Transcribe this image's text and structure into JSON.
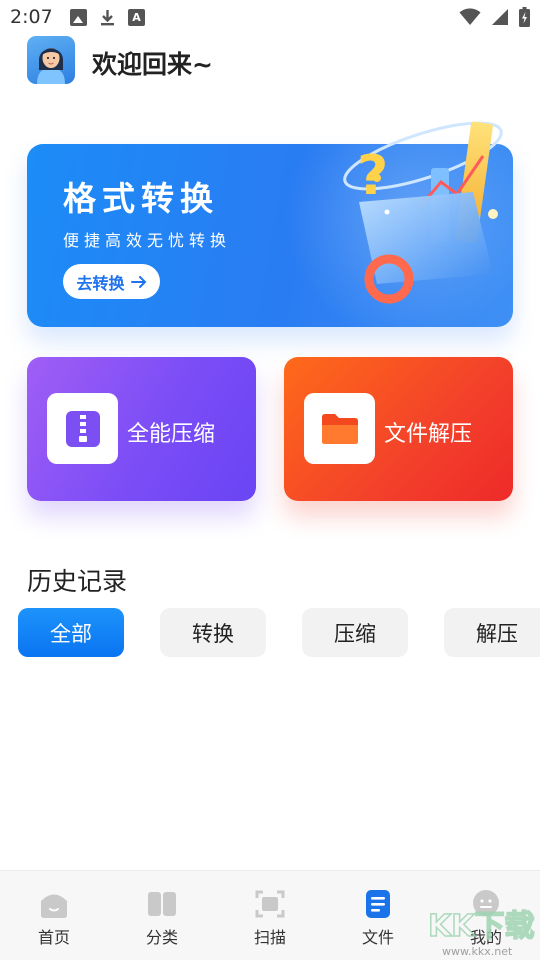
{
  "status_bar": {
    "time": "2:07",
    "left_icons": [
      "image-icon",
      "download-icon",
      "a-badge-icon"
    ],
    "right_icons": [
      "wifi-icon",
      "signal-icon",
      "battery-icon"
    ]
  },
  "header": {
    "avatar": "avatar",
    "welcome_text": "欢迎回来~"
  },
  "banner": {
    "title": "格式转换",
    "subtitle": "便捷高效无忧转换",
    "button_label": "去转换",
    "button_icon": "arrow-right-icon",
    "colors": {
      "start": "#1c8cf7",
      "end": "#3f90f5"
    }
  },
  "features": [
    {
      "label": "全能压缩",
      "icon": "zip-file-icon",
      "color": "#7b4df6"
    },
    {
      "label": "文件解压",
      "icon": "folder-icon",
      "color": "#f3412a"
    }
  ],
  "history": {
    "title": "历史记录",
    "filters": [
      "全部",
      "转换",
      "压缩",
      "解压"
    ],
    "active_filter": "全部"
  },
  "bottom_nav": {
    "items": [
      {
        "label": "首页",
        "icon": "home-icon"
      },
      {
        "label": "分类",
        "icon": "category-icon"
      },
      {
        "label": "扫描",
        "icon": "scan-icon"
      },
      {
        "label": "文件",
        "icon": "file-icon"
      },
      {
        "label": "我的",
        "icon": "profile-icon"
      }
    ],
    "active": "文件",
    "active_color": "#1a73e8"
  },
  "watermark": "KK下载 www.kkx.net"
}
